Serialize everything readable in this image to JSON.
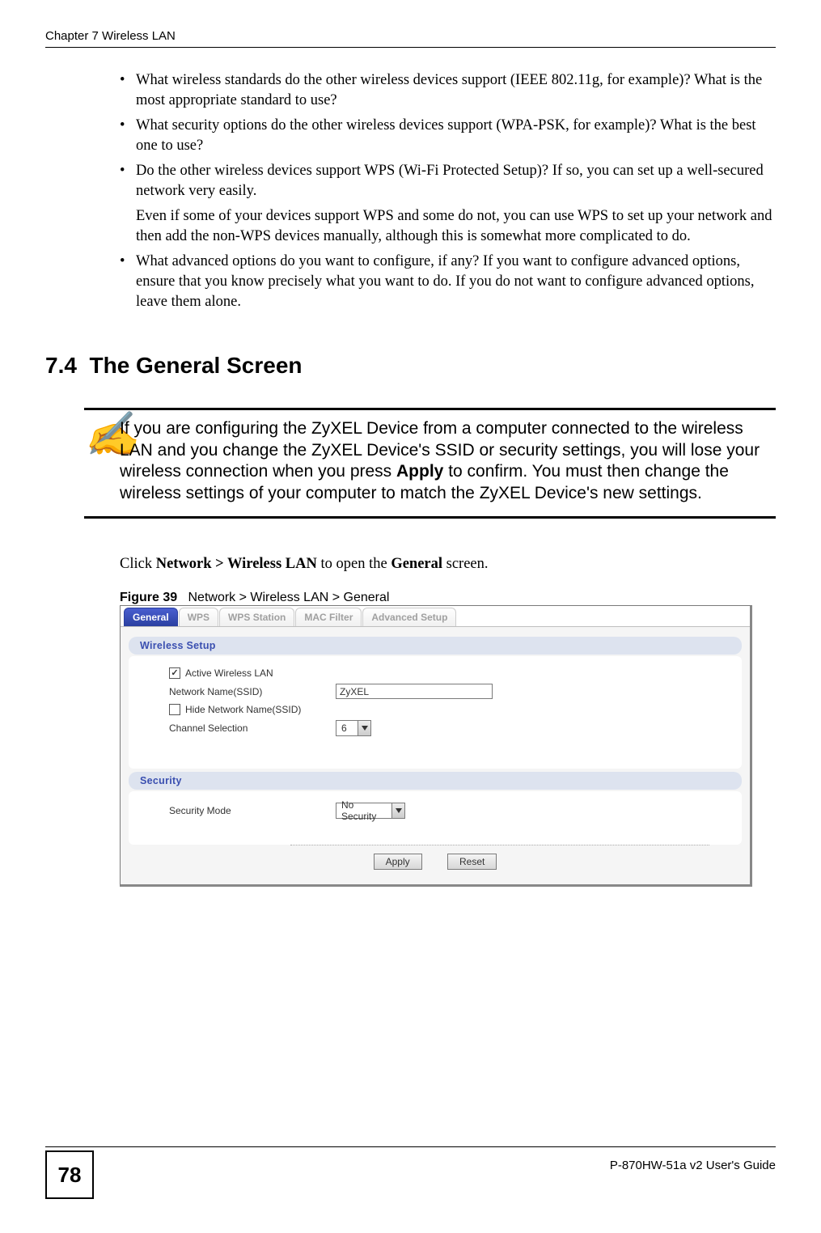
{
  "header": {
    "chapter_title": "Chapter 7 Wireless LAN"
  },
  "bullets": {
    "b1": "What wireless standards do the other wireless devices support (IEEE 802.11g, for example)? What is the most appropriate standard to use?",
    "b2": "What security options do the other wireless devices support (WPA-PSK, for example)? What is the best one to use?",
    "b3a": "Do the other wireless devices support WPS (Wi-Fi Protected Setup)? If so, you can set up a well-secured network very easily.",
    "b3b": "Even if some of your devices support WPS and some do not, you can use WPS to set up your network and then add the non-WPS devices manually, although this is somewhat more complicated to do.",
    "b4": "What advanced options do you want to configure, if any? If you want to configure advanced options, ensure that you know precisely what you want to do. If you do not want to configure advanced options, leave them alone."
  },
  "section": {
    "number": "7.4",
    "title": "The General Screen"
  },
  "note": {
    "icon": "✍",
    "text_pre": "If you are configuring the ZyXEL Device from a computer connected to the wireless LAN and you change the ZyXEL Device's SSID or security settings, you will lose your wireless connection when you press ",
    "text_bold": "Apply",
    "text_post": " to confirm. You must then change the wireless settings of your computer to match the ZyXEL Device's new settings."
  },
  "instruction": {
    "pre": "Click ",
    "bold1": "Network > Wireless LAN",
    "mid": " to open the ",
    "bold2": "General",
    "post": " screen."
  },
  "figure": {
    "label": "Figure 39",
    "caption": "Network > Wireless LAN > General"
  },
  "ui": {
    "tabs": {
      "general": "General",
      "wps": "WPS",
      "wps_station": "WPS Station",
      "mac_filter": "MAC Filter",
      "advanced": "Advanced Setup"
    },
    "wireless_setup": {
      "heading": "Wireless Setup",
      "active_label": "Active Wireless LAN",
      "ssid_label": "Network Name(SSID)",
      "ssid_value": "ZyXEL",
      "hide_label": "Hide Network Name(SSID)",
      "channel_label": "Channel Selection",
      "channel_value": "6"
    },
    "security": {
      "heading": "Security",
      "mode_label": "Security Mode",
      "mode_value": "No Security"
    },
    "buttons": {
      "apply": "Apply",
      "reset": "Reset"
    }
  },
  "footer": {
    "page_number": "78",
    "guide": "P-870HW-51a v2 User's Guide"
  }
}
